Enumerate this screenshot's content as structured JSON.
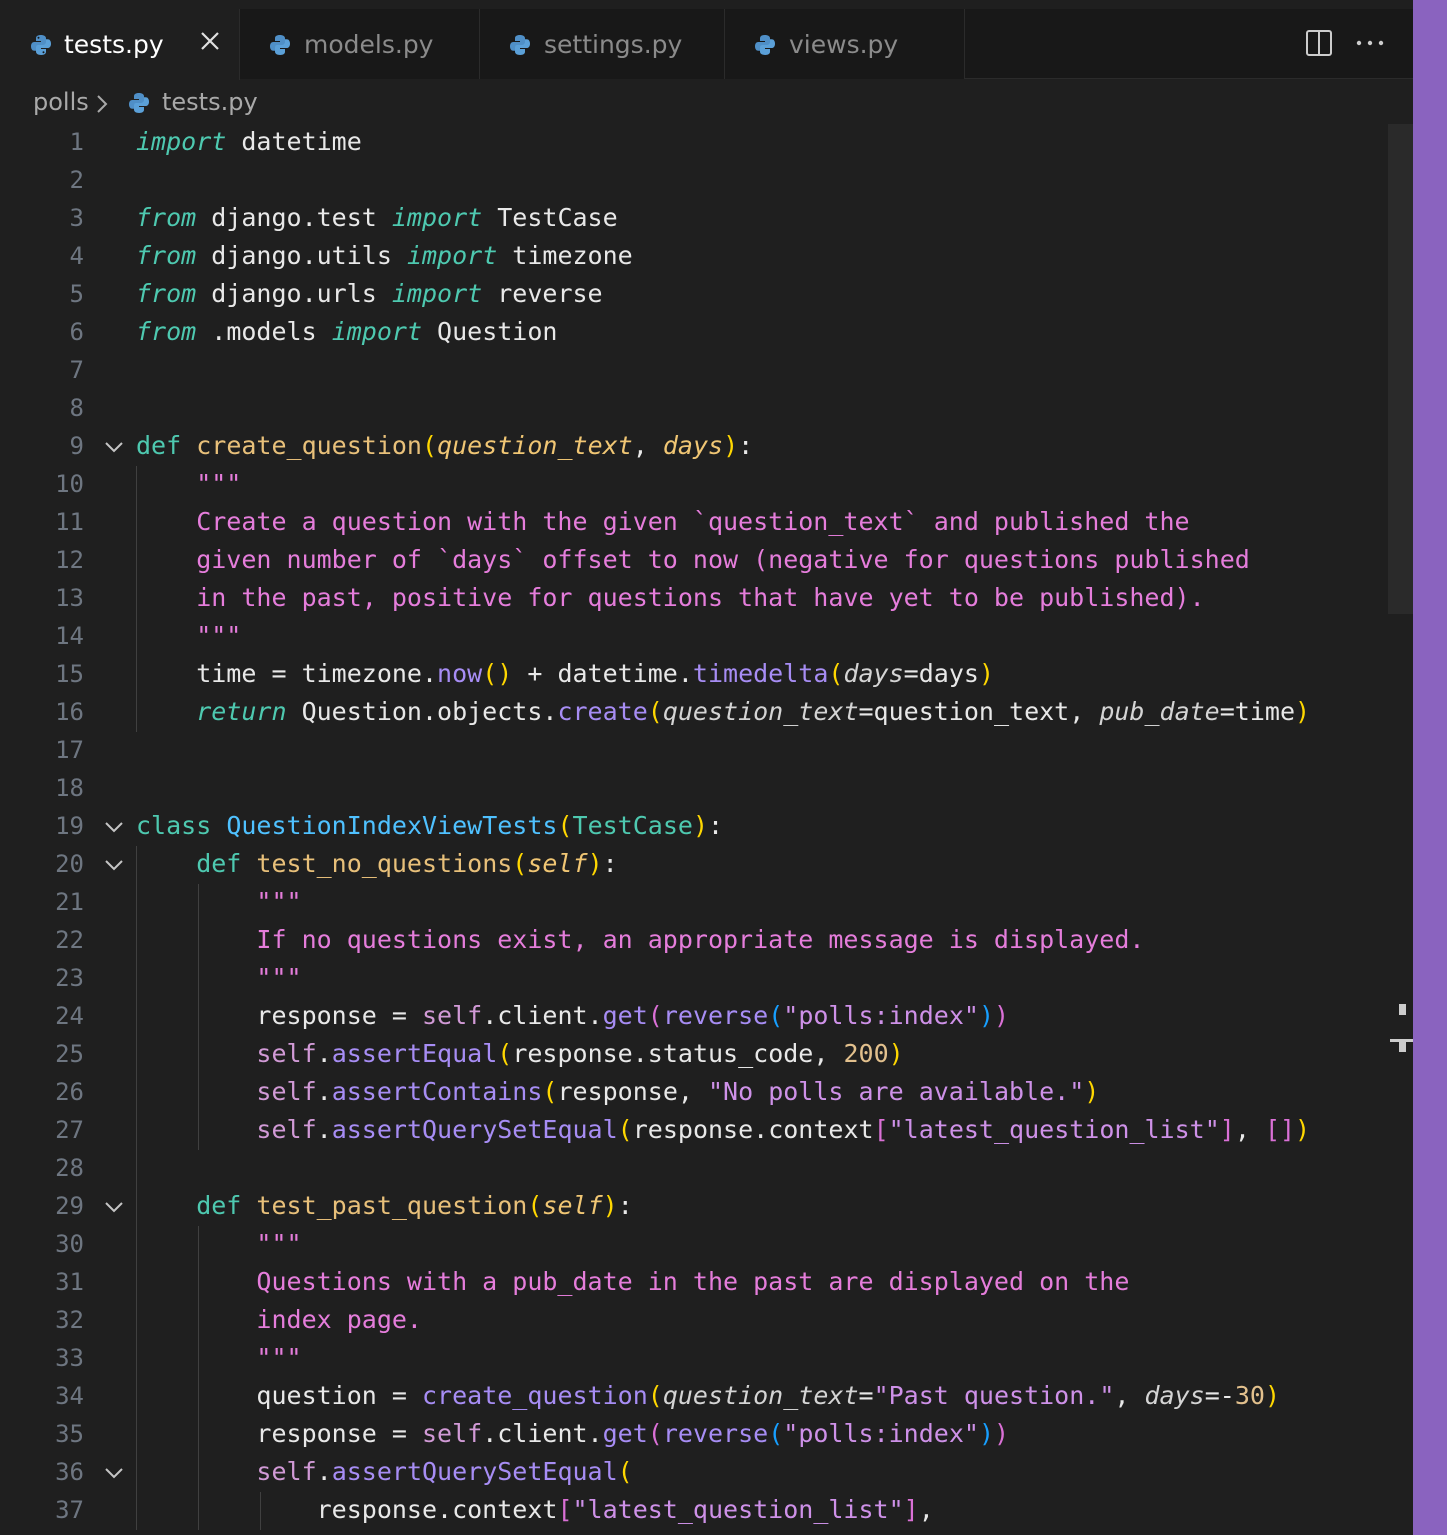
{
  "tabs": [
    {
      "label": "tests.py",
      "active": true,
      "icon": "python-icon"
    },
    {
      "label": "models.py",
      "active": false,
      "icon": "python-icon"
    },
    {
      "label": "settings.py",
      "active": false,
      "icon": "python-icon"
    },
    {
      "label": "views.py",
      "active": false,
      "icon": "python-icon"
    }
  ],
  "breadcrumb": {
    "folder": "polls",
    "file": "tests.py"
  },
  "editor": {
    "line_numbers": [
      "1",
      "2",
      "3",
      "4",
      "5",
      "6",
      "7",
      "8",
      "9",
      "10",
      "11",
      "12",
      "13",
      "14",
      "15",
      "16",
      "17",
      "18",
      "19",
      "20",
      "21",
      "22",
      "23",
      "24",
      "25",
      "26",
      "27",
      "28",
      "29",
      "30",
      "31",
      "32",
      "33",
      "34",
      "35",
      "36",
      "37"
    ],
    "lines": [
      {
        "n": 1,
        "segs": [
          [
            "ki",
            "import"
          ],
          [
            "wht",
            " datetime"
          ]
        ]
      },
      {
        "n": 2,
        "segs": []
      },
      {
        "n": 3,
        "segs": [
          [
            "ki",
            "from"
          ],
          [
            "wht",
            " django.test "
          ],
          [
            "ki",
            "import"
          ],
          [
            "wht",
            " TestCase"
          ]
        ]
      },
      {
        "n": 4,
        "segs": [
          [
            "ki",
            "from"
          ],
          [
            "wht",
            " django.utils "
          ],
          [
            "ki",
            "import"
          ],
          [
            "wht",
            " timezone"
          ]
        ]
      },
      {
        "n": 5,
        "segs": [
          [
            "ki",
            "from"
          ],
          [
            "wht",
            " django.urls "
          ],
          [
            "ki",
            "import"
          ],
          [
            "wht",
            " reverse"
          ]
        ]
      },
      {
        "n": 6,
        "segs": [
          [
            "ki",
            "from"
          ],
          [
            "wht",
            " .models "
          ],
          [
            "ki",
            "import"
          ],
          [
            "wht",
            " Question"
          ]
        ]
      },
      {
        "n": 7,
        "segs": []
      },
      {
        "n": 8,
        "segs": []
      },
      {
        "n": 9,
        "fold": true,
        "segs": [
          [
            "k",
            "def"
          ],
          [
            "wht",
            " "
          ],
          [
            "fn2",
            "create_question"
          ],
          [
            "p",
            "("
          ],
          [
            "prm",
            "question_text"
          ],
          [
            "wht",
            ", "
          ],
          [
            "prm",
            "days"
          ],
          [
            "p",
            ")"
          ],
          [
            "wht",
            ":"
          ]
        ]
      },
      {
        "n": 10,
        "segs": [
          [
            "doc",
            "    \"\"\""
          ]
        ]
      },
      {
        "n": 11,
        "segs": [
          [
            "doc",
            "    Create a question with the given `question_text` and published the"
          ]
        ]
      },
      {
        "n": 12,
        "segs": [
          [
            "doc",
            "    given number of `days` offset to now (negative for questions published"
          ]
        ]
      },
      {
        "n": 13,
        "segs": [
          [
            "doc",
            "    in the past, positive for questions that have yet to be published)."
          ]
        ]
      },
      {
        "n": 14,
        "segs": [
          [
            "doc",
            "    \"\"\""
          ]
        ]
      },
      {
        "n": 15,
        "segs": [
          [
            "wht",
            "    time = timezone."
          ],
          [
            "mth",
            "now"
          ],
          [
            "p",
            "()"
          ],
          [
            "wht",
            " + datetime."
          ],
          [
            "mth",
            "timedelta"
          ],
          [
            "p",
            "("
          ],
          [
            "kwarg",
            "days"
          ],
          [
            "wht",
            "=days"
          ],
          [
            "p",
            ")"
          ]
        ]
      },
      {
        "n": 16,
        "segs": [
          [
            "ki",
            "    return"
          ],
          [
            "wht",
            " Question.objects."
          ],
          [
            "mth",
            "create"
          ],
          [
            "p",
            "("
          ],
          [
            "kwarg",
            "question_text"
          ],
          [
            "wht",
            "=question_text, "
          ],
          [
            "kwarg",
            "pub_date"
          ],
          [
            "wht",
            "=time"
          ],
          [
            "p",
            ")"
          ]
        ]
      },
      {
        "n": 17,
        "segs": []
      },
      {
        "n": 18,
        "segs": []
      },
      {
        "n": 19,
        "fold": true,
        "segs": [
          [
            "k",
            "class"
          ],
          [
            "wht",
            " "
          ],
          [
            "cls",
            "QuestionIndexViewTests"
          ],
          [
            "p",
            "("
          ],
          [
            "k",
            "TestCase"
          ],
          [
            "p",
            ")"
          ],
          [
            "wht",
            ":"
          ]
        ]
      },
      {
        "n": 20,
        "fold": true,
        "segs": [
          [
            "k",
            "    def"
          ],
          [
            "wht",
            " "
          ],
          [
            "fn2",
            "test_no_questions"
          ],
          [
            "p",
            "("
          ],
          [
            "prm",
            "self"
          ],
          [
            "p",
            ")"
          ],
          [
            "wht",
            ":"
          ]
        ]
      },
      {
        "n": 21,
        "segs": [
          [
            "doc",
            "        \"\"\""
          ]
        ]
      },
      {
        "n": 22,
        "segs": [
          [
            "doc",
            "        If no questions exist, an appropriate message is displayed."
          ]
        ]
      },
      {
        "n": 23,
        "segs": [
          [
            "doc",
            "        \"\"\""
          ]
        ]
      },
      {
        "n": 24,
        "segs": [
          [
            "wht",
            "        response = "
          ],
          [
            "slf",
            "self"
          ],
          [
            "wht",
            ".client."
          ],
          [
            "mth",
            "get"
          ],
          [
            "p2",
            "("
          ],
          [
            "mth",
            "reverse"
          ],
          [
            "p3",
            "("
          ],
          [
            "str",
            "\"polls:index\""
          ],
          [
            "p3",
            ")"
          ],
          [
            "p2",
            ")"
          ]
        ]
      },
      {
        "n": 25,
        "segs": [
          [
            "slf",
            "        self"
          ],
          [
            "wht",
            "."
          ],
          [
            "mth",
            "assertEqual"
          ],
          [
            "p",
            "("
          ],
          [
            "wht",
            "response.status_code, "
          ],
          [
            "num",
            "200"
          ],
          [
            "p",
            ")"
          ]
        ]
      },
      {
        "n": 26,
        "segs": [
          [
            "slf",
            "        self"
          ],
          [
            "wht",
            "."
          ],
          [
            "mth",
            "assertContains"
          ],
          [
            "p",
            "("
          ],
          [
            "wht",
            "response, "
          ],
          [
            "str",
            "\"No polls are available.\""
          ],
          [
            "p",
            ")"
          ]
        ]
      },
      {
        "n": 27,
        "segs": [
          [
            "slf",
            "        self"
          ],
          [
            "wht",
            "."
          ],
          [
            "mth",
            "assertQuerySetEqual"
          ],
          [
            "p",
            "("
          ],
          [
            "wht",
            "response.context"
          ],
          [
            "p2",
            "["
          ],
          [
            "str",
            "\"latest_question_list\""
          ],
          [
            "p2",
            "]"
          ],
          [
            "wht",
            ", "
          ],
          [
            "p2",
            "[]"
          ],
          [
            "p",
            ")"
          ]
        ]
      },
      {
        "n": 28,
        "segs": []
      },
      {
        "n": 29,
        "fold": true,
        "segs": [
          [
            "k",
            "    def"
          ],
          [
            "wht",
            " "
          ],
          [
            "fn2",
            "test_past_question"
          ],
          [
            "p",
            "("
          ],
          [
            "prm",
            "self"
          ],
          [
            "p",
            ")"
          ],
          [
            "wht",
            ":"
          ]
        ]
      },
      {
        "n": 30,
        "segs": [
          [
            "doc",
            "        \"\"\""
          ]
        ]
      },
      {
        "n": 31,
        "segs": [
          [
            "doc",
            "        Questions with a pub_date in the past are displayed on the"
          ]
        ]
      },
      {
        "n": 32,
        "segs": [
          [
            "doc",
            "        index page."
          ]
        ]
      },
      {
        "n": 33,
        "segs": [
          [
            "doc",
            "        \"\"\""
          ]
        ]
      },
      {
        "n": 34,
        "segs": [
          [
            "wht",
            "        question = "
          ],
          [
            "mth",
            "create_question"
          ],
          [
            "p",
            "("
          ],
          [
            "kwarg",
            "question_text"
          ],
          [
            "wht",
            "="
          ],
          [
            "str",
            "\"Past question.\""
          ],
          [
            "wht",
            ", "
          ],
          [
            "kwarg",
            "days"
          ],
          [
            "wht",
            "=-"
          ],
          [
            "num",
            "30"
          ],
          [
            "p",
            ")"
          ]
        ]
      },
      {
        "n": 35,
        "segs": [
          [
            "wht",
            "        response = "
          ],
          [
            "slf",
            "self"
          ],
          [
            "wht",
            ".client."
          ],
          [
            "mth",
            "get"
          ],
          [
            "p2",
            "("
          ],
          [
            "mth",
            "reverse"
          ],
          [
            "p3",
            "("
          ],
          [
            "str",
            "\"polls:index\""
          ],
          [
            "p3",
            ")"
          ],
          [
            "p2",
            ")"
          ]
        ]
      },
      {
        "n": 36,
        "fold": true,
        "segs": [
          [
            "slf",
            "        self"
          ],
          [
            "wht",
            "."
          ],
          [
            "mth",
            "assertQuerySetEqual"
          ],
          [
            "p",
            "("
          ]
        ]
      },
      {
        "n": 37,
        "segs": [
          [
            "wht",
            "            response.context"
          ],
          [
            "p2",
            "["
          ],
          [
            "str",
            "\"latest_question_list\""
          ],
          [
            "p2",
            "]"
          ],
          [
            "wht",
            ","
          ]
        ]
      }
    ]
  },
  "colors": {
    "accent_right_edge": "#8a63bf",
    "background": "#1f1f1f"
  }
}
